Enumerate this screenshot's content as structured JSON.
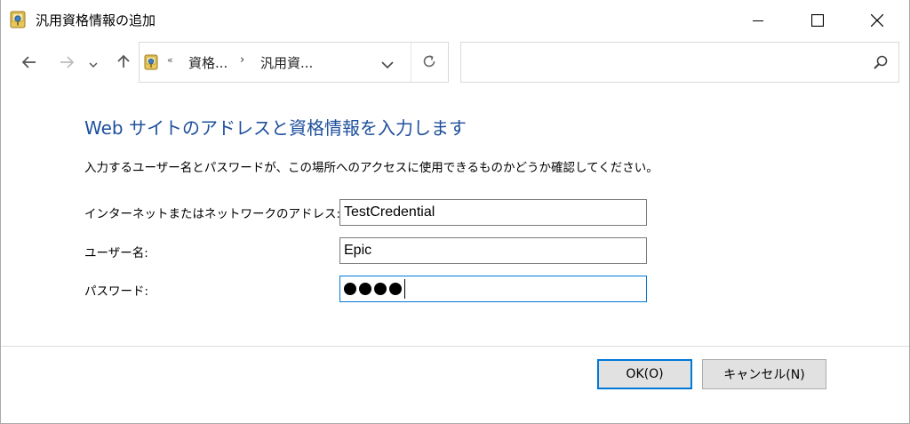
{
  "window": {
    "title": "汎用資格情報の追加"
  },
  "address_bar": {
    "overflow_chevron": "«",
    "crumbs": [
      "資格...",
      "汎用資..."
    ],
    "separator": "›"
  },
  "search": {
    "placeholder": ""
  },
  "content": {
    "heading": "Web サイトのアドレスと資格情報を入力します",
    "description": "入力するユーザー名とパスワードが、この場所へのアクセスに使用できるものかどうか確認してください。",
    "fields": {
      "address_label": "インターネットまたはネットワークのアドレス:",
      "address_value": "TestCredential",
      "username_label": "ユーザー名:",
      "username_value": "Epic",
      "password_label": "パスワード:",
      "password_masked_length": 4
    }
  },
  "buttons": {
    "ok": "OK(O)",
    "cancel": "キャンセル(N)"
  },
  "icons": {
    "title": "credential-manager-icon",
    "minimize": "minimize-icon",
    "maximize": "maximize-icon",
    "close": "close-icon",
    "back": "back-arrow-icon",
    "forward": "forward-arrow-icon",
    "recent": "chevron-down-icon",
    "up": "up-arrow-icon",
    "refresh": "refresh-icon",
    "search": "search-icon"
  },
  "colors": {
    "heading": "#1e4f9c",
    "focus": "#0078d7"
  }
}
